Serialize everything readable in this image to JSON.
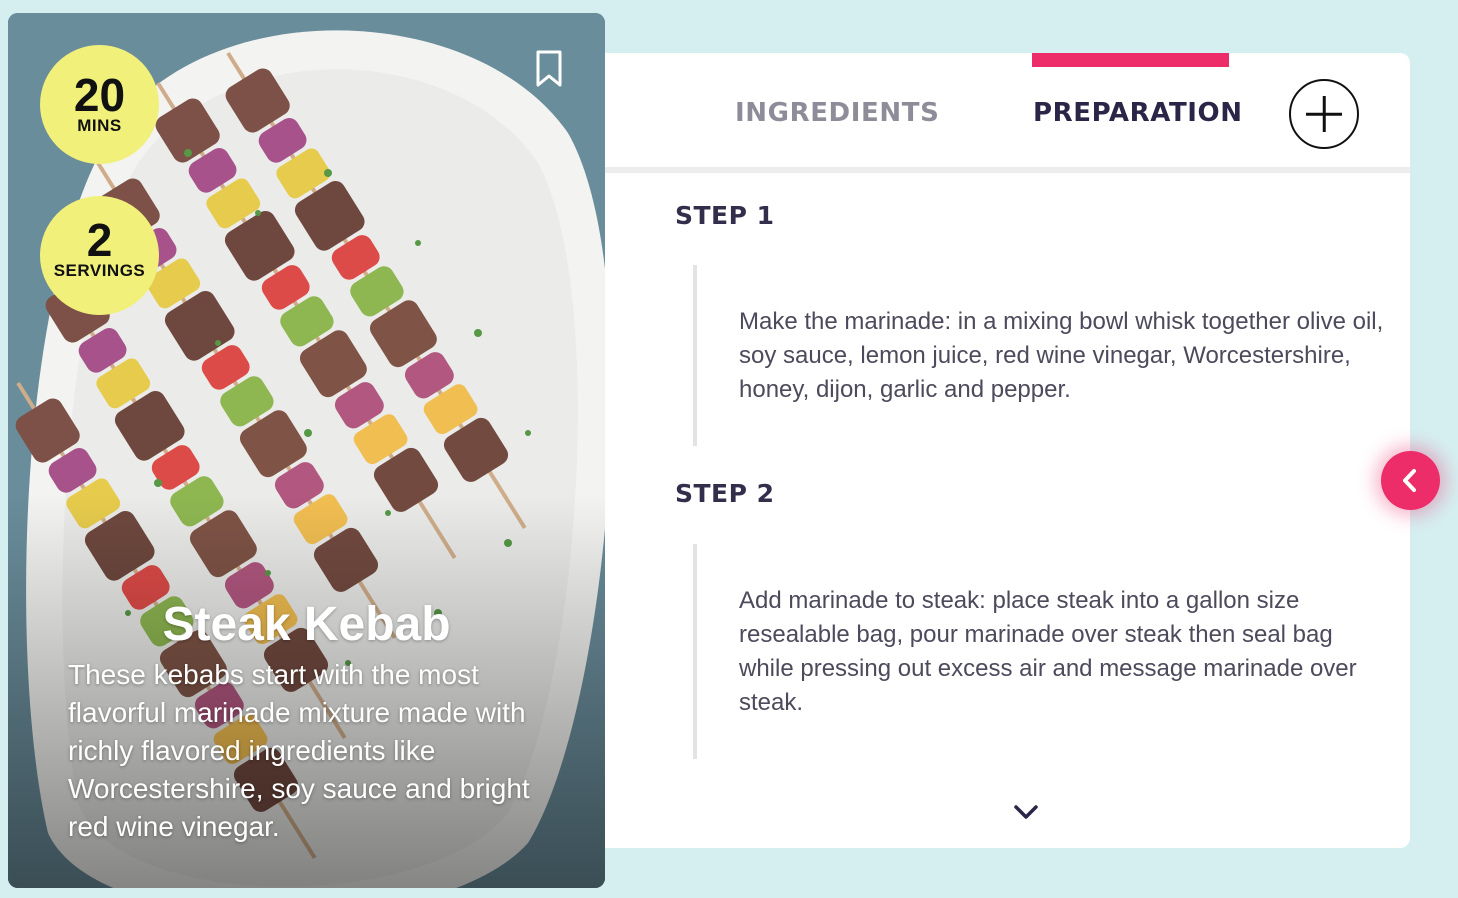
{
  "recipe": {
    "title": "Steak Kebab",
    "description": "These kebabs start with the most flavorful marinade mixture made with richly flavored ingredients like Worcestershire, soy sauce and bright red wine vinegar.",
    "time_value": "20",
    "time_unit": "MINS",
    "servings_value": "2",
    "servings_unit": "SERVINGS"
  },
  "tabs": {
    "ingredients": "INGREDIENTS",
    "preparation": "PREPARATION",
    "active": "preparation"
  },
  "steps": [
    {
      "title": "STEP 1",
      "text": "Make the marinade: in a mixing bowl whisk together olive oil, soy sauce, lemon juice, red wine vinegar, Worcestershire, honey, dijon, garlic and pepper."
    },
    {
      "title": "STEP 2",
      "text": "Add marinade to steak: place steak into a gallon size resealable bag, pour marinade over steak then seal bag while pressing out excess air and message marinade over steak."
    }
  ],
  "colors": {
    "background": "#d5eff1",
    "accent": "#ec2d69",
    "badge": "#f1f07a",
    "heading": "#2b2647"
  },
  "icons": {
    "bookmark": "bookmark-icon",
    "add": "plus-icon",
    "prev": "chevron-left-icon",
    "scroll": "chevron-down-icon"
  }
}
